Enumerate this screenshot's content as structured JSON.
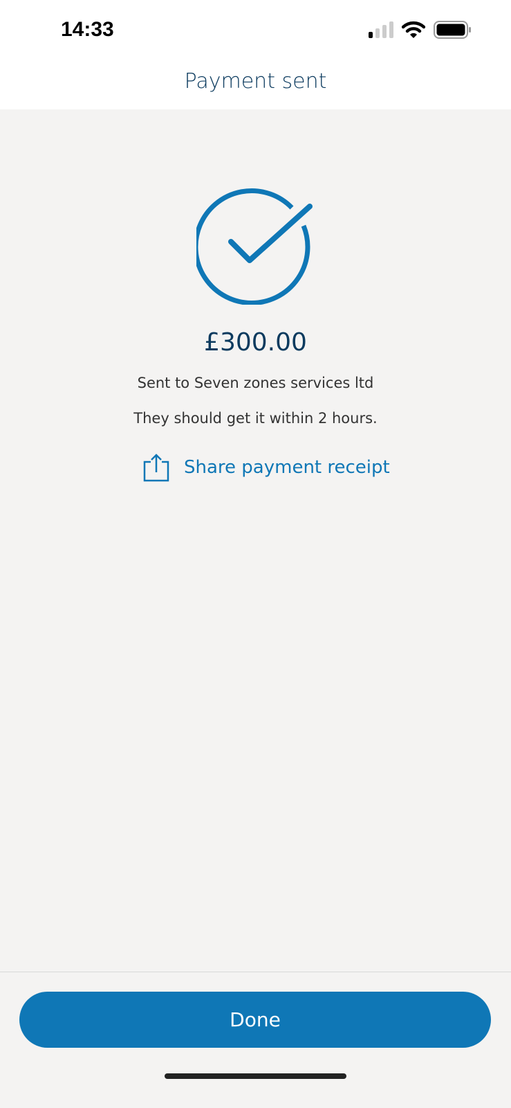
{
  "status_bar": {
    "time": "14:33"
  },
  "header": {
    "title": "Payment sent"
  },
  "confirmation": {
    "amount": "£300.00",
    "recipient_text": "Sent to Seven zones services ltd",
    "eta_text": "They should get it within 2 hours.",
    "share_label": "Share payment receipt"
  },
  "footer": {
    "done_label": "Done"
  },
  "colors": {
    "accent": "#0f77b6",
    "heading": "#0b3a5e"
  }
}
